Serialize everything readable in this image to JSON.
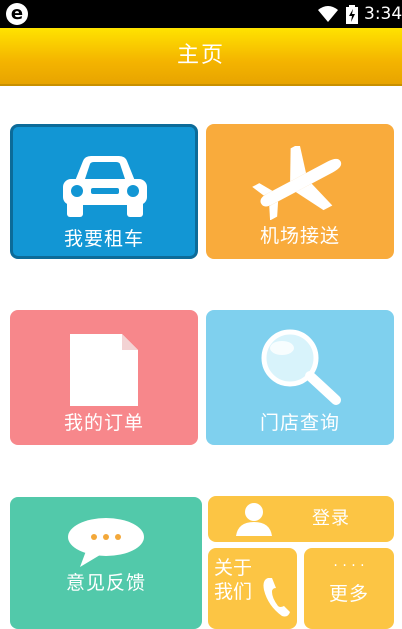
{
  "status_bar": {
    "app_icon": "e",
    "time": "3:34",
    "icons": [
      "wifi-icon",
      "battery-icon"
    ]
  },
  "header": {
    "title": "主页"
  },
  "tiles": {
    "rent_car": {
      "label": "我要租车",
      "icon": "car-icon",
      "color": "#1296d4"
    },
    "airport": {
      "label": "机场接送",
      "icon": "airplane-icon",
      "color": "#f9ab3c"
    },
    "orders": {
      "label": "我的订单",
      "icon": "document-icon",
      "color": "#f7878b"
    },
    "store_search": {
      "label": "门店查询",
      "icon": "magnifier-icon",
      "color": "#7fd0ee"
    },
    "feedback": {
      "label": "意见反馈",
      "icon": "chat-bubble-icon",
      "color": "#52c9aa"
    },
    "login": {
      "label": "登录",
      "icon": "user-icon",
      "color": "#fcc544"
    },
    "about": {
      "label_line1": "关于",
      "label_line2": "我们",
      "icon": "phone-icon",
      "color": "#fcc544"
    },
    "more": {
      "label": "更多",
      "dots": "· · · ·",
      "color": "#fcc544"
    }
  }
}
